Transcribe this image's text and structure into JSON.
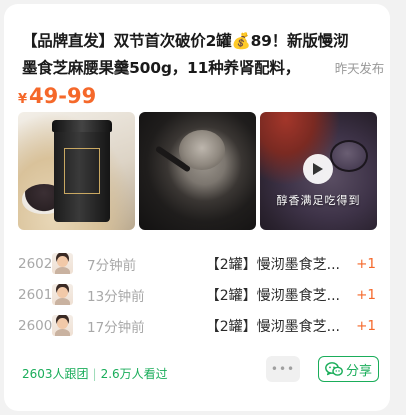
{
  "post": {
    "title_line1": "【品牌直发】双节首次破价2罐💰89！新版慢沏",
    "title_line2": "墨食芝麻腰果羹500g，11种养肾配料，",
    "posted": "昨天发布",
    "price_symbol": "¥",
    "price": "49-99",
    "accent_color": "#f5682a"
  },
  "photos": [
    {
      "name": "product-jar-photo",
      "content": "black jar of sesame cashew paste on a table"
    },
    {
      "name": "spoon-paste-photo",
      "content": "spoon lifting paste from the jar"
    },
    {
      "name": "bowl-video-thumbnail",
      "content": "bowl of dark sesame porridge",
      "icon": "play-icon",
      "caption": "醇香满足吃得到"
    }
  ],
  "followers": [
    {
      "num": "2602",
      "time": "7分钟前",
      "product": "【2罐】慢沏墨食芝...",
      "qty": "+1"
    },
    {
      "num": "2601",
      "time": "13分钟前",
      "product": "【2罐】慢沏墨食芝...",
      "qty": "+1"
    },
    {
      "num": "2600",
      "time": "17分钟前",
      "product": "【2罐】慢沏墨食芝...",
      "qty": "+1"
    }
  ],
  "footer": {
    "joined": "2603人跟团",
    "separator": "|",
    "viewed": "2.6万人看过",
    "more_label": "•••",
    "more_icon": "more-icon",
    "share_icon": "wechat-icon",
    "share_label": "分享",
    "brand_color": "#1aad5a"
  }
}
